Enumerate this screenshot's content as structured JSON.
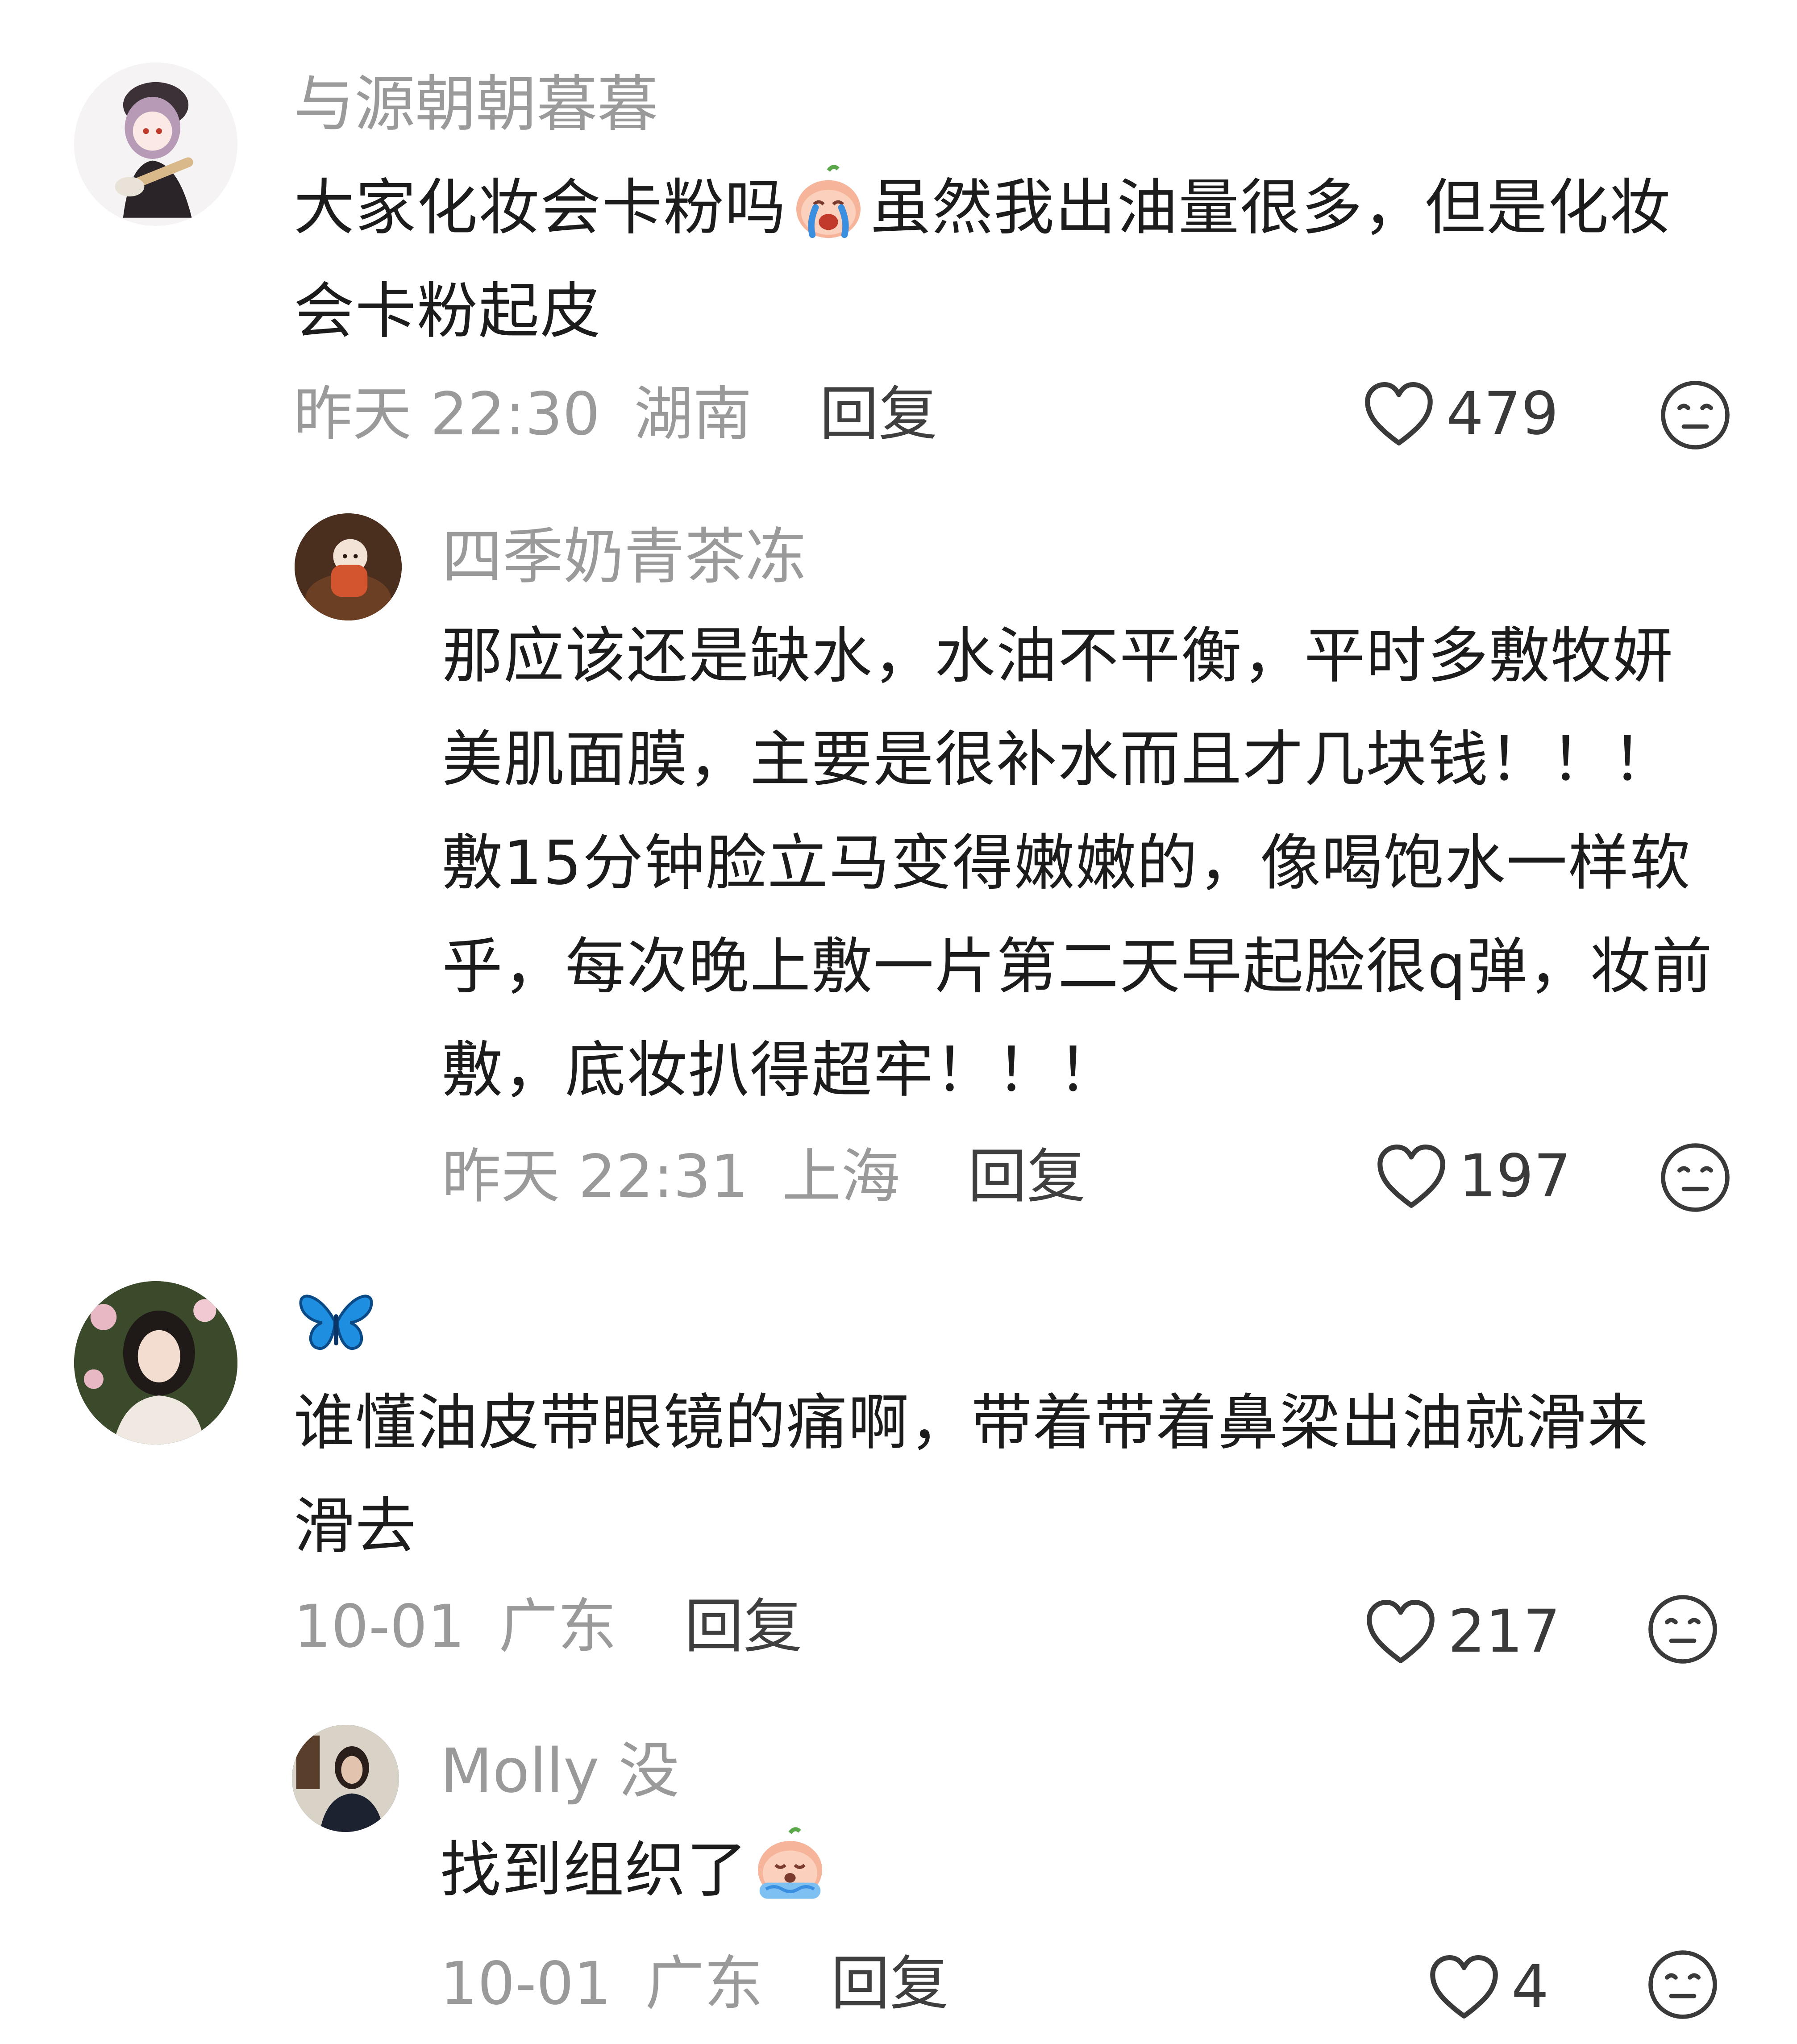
{
  "comments": [
    {
      "author": "与源朝朝暮暮",
      "text_before": "大家化妆会卡粉吗",
      "emoji": "crying-peach-emoji",
      "text_after": "虽然我出油量很多，但是化妆会卡粉起皮",
      "date": "昨天 22:30",
      "location": "湖南",
      "reply_label": "回复",
      "likes": "479"
    },
    {
      "author": "四季奶青茶冻",
      "text": "那应该还是缺水，水油不平衡，平时多敷牧妍美肌面膜，主要是很补水而且才几块钱！！！敷15分钟脸立马变得嫩嫩的，像喝饱水一样软乎，每次晚上敷一片第二天早起脸很q弹，妆前敷，底妆扒得超牢！！！",
      "date": "昨天 22:31",
      "location": "上海",
      "reply_label": "回复",
      "likes": "197"
    },
    {
      "author_icon": "blue-butterfly-icon",
      "text": "谁懂油皮带眼镜的痛啊，带着带着鼻梁出油就滑来滑去",
      "date": "10-01",
      "location": "广东",
      "reply_label": "回复",
      "likes": "217"
    },
    {
      "author": "Molly 没",
      "text_before": "找到组织了",
      "emoji": "sobbing-peach-emoji",
      "date": "10-01",
      "location": "广东",
      "reply_label": "回复",
      "likes": "4"
    }
  ],
  "colors": {
    "author": "#9a9a9a",
    "body": "#1c1c1c",
    "meta": "#9a9a9a",
    "reply": "#3f3f3f",
    "icon": "#3a3a3a",
    "butterfly": "#1e8fe0"
  }
}
